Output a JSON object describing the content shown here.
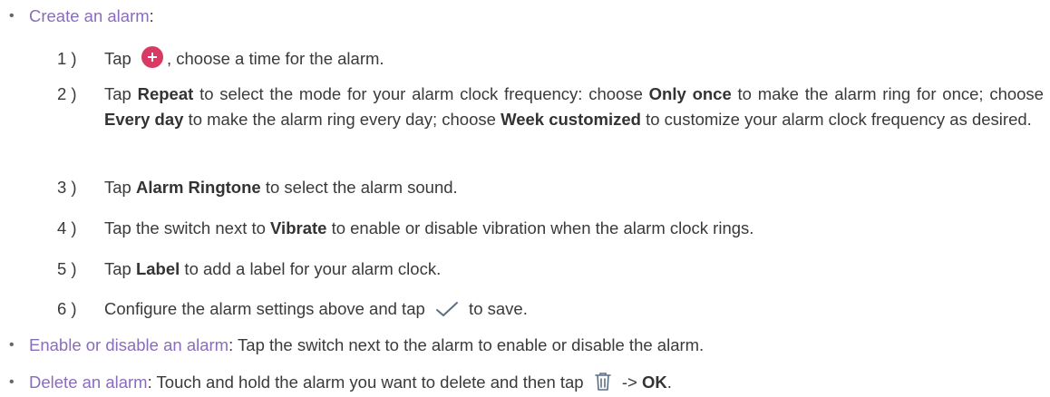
{
  "sections": {
    "create": {
      "title": "Create an alarm",
      "suffix": ":",
      "steps": [
        {
          "num": "1 )",
          "pre": "Tap",
          "icon": "plus-icon",
          "post": ", choose a time for the alarm."
        },
        {
          "num": "2 )",
          "t1": "Tap ",
          "b1": "Repeat",
          "t2": " to select the mode for your alarm clock frequency: choose ",
          "b2": "Only once",
          "t3": " to make the alarm ring for once; choose ",
          "b3": "Every day",
          "t4": " to make the alarm ring every day; choose ",
          "b4": "Week customized",
          "t5": " to customize your alarm clock frequency as desired."
        },
        {
          "num": "3 )",
          "t1": "Tap ",
          "b1": "Alarm Ringtone",
          "t2": " to select the alarm sound."
        },
        {
          "num": "4 )",
          "t1": "Tap the switch next to ",
          "b1": "Vibrate",
          "t2": " to enable or disable vibration when the alarm clock rings."
        },
        {
          "num": "5 )",
          "t1": "Tap ",
          "b1": "Label",
          "t2": " to add a label for your alarm clock."
        },
        {
          "num": "6 )",
          "pre": "Configure the alarm settings above and tap",
          "icon": "check-icon",
          "post": "to save."
        }
      ]
    },
    "enable": {
      "title": "Enable or disable an alarm",
      "suffix": ": Tap the switch next to the alarm to enable or disable the alarm."
    },
    "delete": {
      "title": "Delete an alarm",
      "suffix": ": Touch and hold the alarm you want to delete and then tap",
      "icon": "trash-icon",
      "arrow": "->",
      "ok": "OK",
      "end": "."
    }
  },
  "colors": {
    "link": "#8a6db8",
    "text": "#3a3a3a",
    "plus_icon_bg": "#d93a63"
  }
}
